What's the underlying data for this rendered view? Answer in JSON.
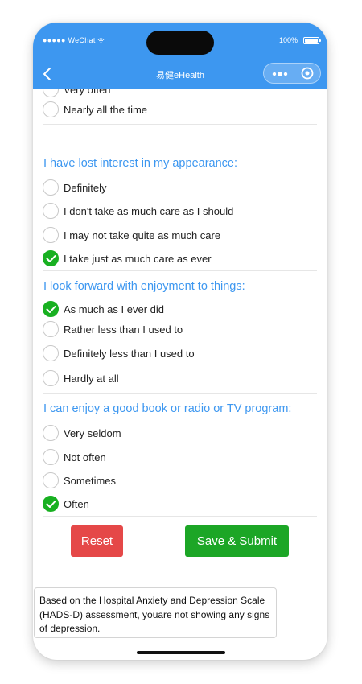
{
  "status": {
    "carrier": "WeChat",
    "battery": "100%"
  },
  "nav": {
    "title": "易健eHealth"
  },
  "partial_option": {
    "label": "Very often"
  },
  "q0": {
    "options": [
      {
        "label": "Nearly all the time",
        "checked": false
      }
    ]
  },
  "q1": {
    "question": "I have lost interest in my appearance:",
    "options": [
      {
        "label": "Definitely",
        "checked": false
      },
      {
        "label": "I don't take as much care as I should",
        "checked": false
      },
      {
        "label": "I may not take quite as much care",
        "checked": false
      },
      {
        "label": "I take just as much care as ever",
        "checked": true
      }
    ]
  },
  "q2": {
    "question": "I look forward with enjoyment to things:",
    "options": [
      {
        "label": "As much as I ever did",
        "checked": true
      },
      {
        "label": "Rather less than I used to",
        "checked": false
      },
      {
        "label": "Definitely less than I used to",
        "checked": false
      },
      {
        "label": "Hardly at all",
        "checked": false
      }
    ]
  },
  "q3": {
    "question": "I can enjoy a good book or radio or TV program:",
    "options": [
      {
        "label": "Very seldom",
        "checked": false
      },
      {
        "label": "Not often",
        "checked": false
      },
      {
        "label": "Sometimes",
        "checked": false
      },
      {
        "label": "Often",
        "checked": true
      }
    ]
  },
  "buttons": {
    "reset": "Reset",
    "submit": "Save & Submit"
  },
  "result": {
    "text": "Based on the Hospital Anxiety and Depression Scale (HADS-D) assessment, youare not showing any signs of depression."
  },
  "colors": {
    "primary": "#3d97f0",
    "checked": "#18b021",
    "reset": "#e54848",
    "submit": "#1ca626"
  }
}
